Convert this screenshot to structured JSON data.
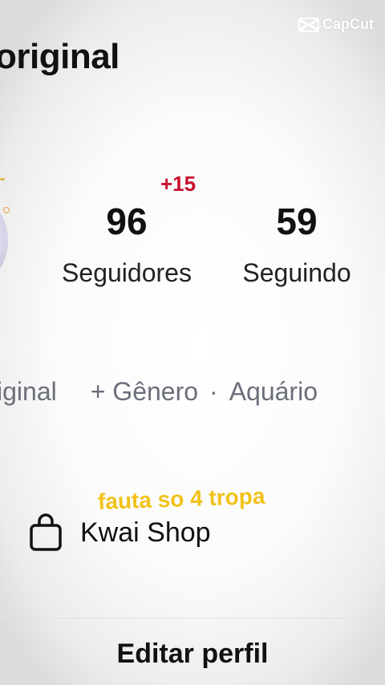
{
  "watermark": {
    "text": "CapCut",
    "icon": "capcut-logo-icon"
  },
  "profile": {
    "name_fragment": "original"
  },
  "stats": {
    "followers": {
      "count": "96",
      "label": "Seguidores",
      "badge": "+15"
    },
    "following": {
      "count": "59",
      "label": "Seguindo"
    }
  },
  "tags": {
    "tag1": "iginal",
    "tag2": "+ Gênero",
    "separator": "·",
    "tag3": "Aquário"
  },
  "overlay_caption": "fauta so 4 tropa",
  "shop": {
    "label": "Kwai Shop",
    "icon": "shopping-bag-icon"
  },
  "actions": {
    "edit_profile": "Editar perfil"
  },
  "colors": {
    "badge": "#c8102e",
    "caption": "#f2c21a",
    "text": "#111111",
    "muted": "#6b6f7a"
  }
}
